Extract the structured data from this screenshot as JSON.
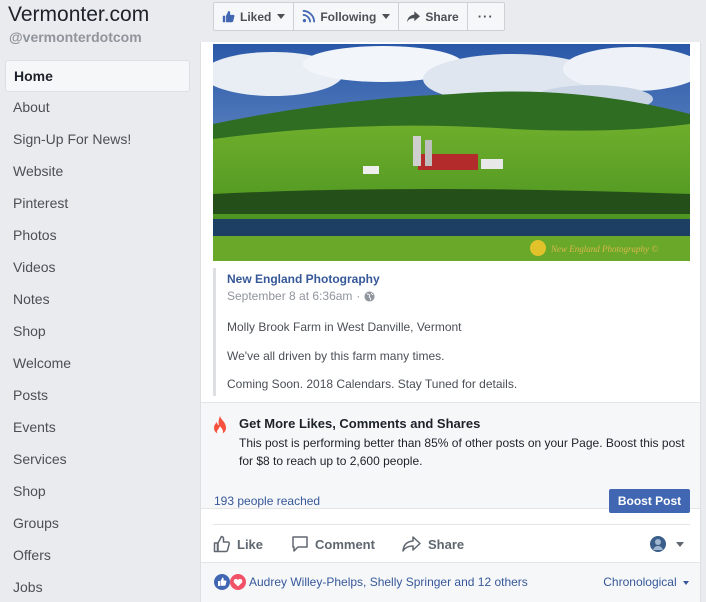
{
  "sidebar": {
    "page_name": "Vermonter.com",
    "handle": "@vermonterdotcom",
    "items": [
      {
        "label": "Home"
      },
      {
        "label": "About"
      },
      {
        "label": "Sign-Up For News!"
      },
      {
        "label": "Website"
      },
      {
        "label": "Pinterest"
      },
      {
        "label": "Photos"
      },
      {
        "label": "Videos"
      },
      {
        "label": "Notes"
      },
      {
        "label": "Shop"
      },
      {
        "label": "Welcome"
      },
      {
        "label": "Posts"
      },
      {
        "label": "Events"
      },
      {
        "label": "Services"
      },
      {
        "label": "Shop"
      },
      {
        "label": "Groups"
      },
      {
        "label": "Offers"
      },
      {
        "label": "Jobs"
      }
    ]
  },
  "toolbar": {
    "liked_label": "Liked",
    "following_label": "Following",
    "share_label": "Share",
    "more_label": "···"
  },
  "post": {
    "source_name": "New England Photography",
    "timestamp": "September 8 at 6:36am",
    "separator": "·",
    "paragraphs": [
      "Molly Brook Farm in West Danville, Vermont",
      "We've all driven by this farm many times.",
      "Coming Soon. 2018 Calendars. Stay Tuned for details."
    ]
  },
  "boost": {
    "title": "Get More Likes, Comments and Shares",
    "body": "This post is performing better than 85% of other posts on your Page. Boost this post for $8 to reach up to 2,600 people.",
    "reached": "193 people reached",
    "button": "Boost Post"
  },
  "actions": {
    "like": "Like",
    "comment": "Comment",
    "share": "Share"
  },
  "reactions": {
    "names": "Audrey Willey-Phelps, Shelly Springer and 12 others",
    "sort": "Chronological"
  },
  "colors": {
    "fb_blue": "#4267b2",
    "link_blue": "#365899",
    "flame": "#f5533d"
  }
}
